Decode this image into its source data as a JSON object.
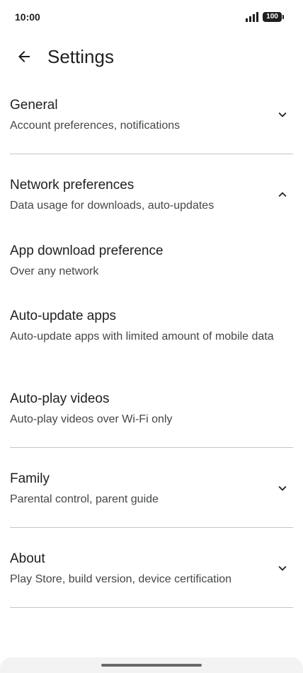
{
  "status_bar": {
    "time": "10:00",
    "battery": "100"
  },
  "header": {
    "title": "Settings"
  },
  "sections": {
    "general": {
      "title": "General",
      "subtitle": "Account preferences, notifications"
    },
    "network": {
      "title": "Network preferences",
      "subtitle": "Data usage for downloads, auto-updates"
    },
    "app_download": {
      "title": "App download preference",
      "subtitle": "Over any network"
    },
    "auto_update": {
      "title": "Auto-update apps",
      "subtitle": "Auto-update apps with limited amount of mobile data"
    },
    "auto_play": {
      "title": "Auto-play videos",
      "subtitle": "Auto-play videos over Wi-Fi only"
    },
    "family": {
      "title": "Family",
      "subtitle": "Parental control, parent guide"
    },
    "about": {
      "title": "About",
      "subtitle": "Play Store, build version, device certification"
    }
  },
  "colors": {
    "text": "#1f1f1f",
    "secondary": "#444746",
    "divider": "#c4c7c5"
  }
}
